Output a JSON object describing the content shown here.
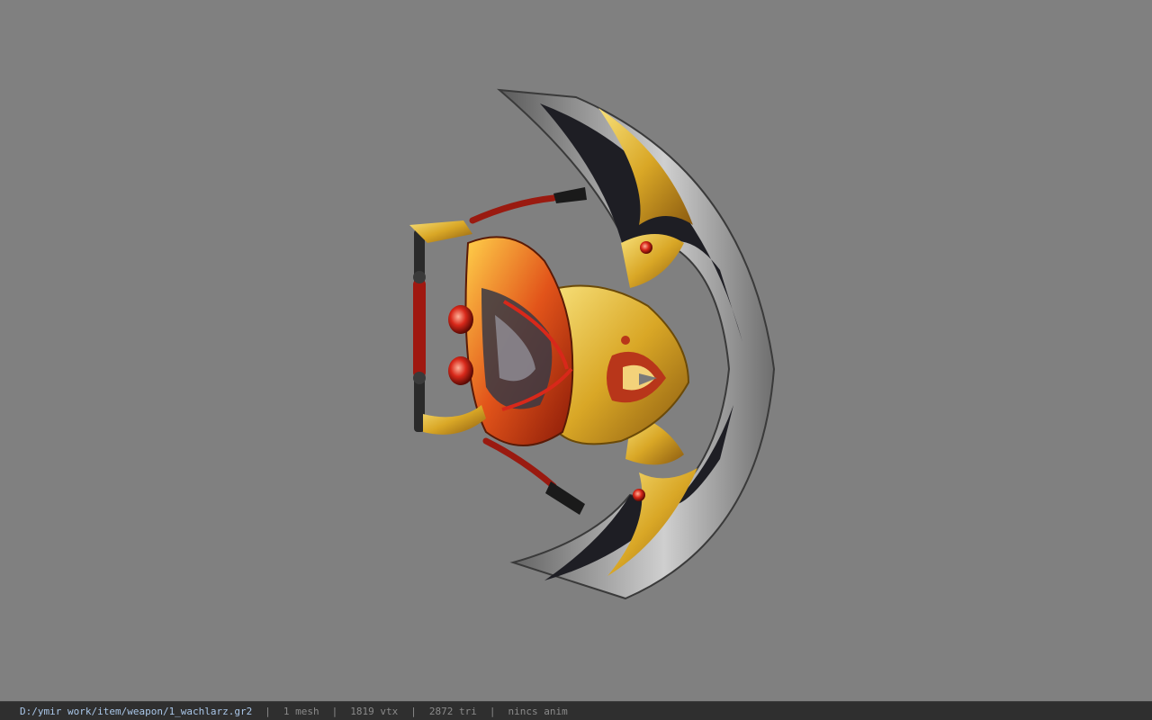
{
  "viewer": {
    "background": "#808080",
    "model": {
      "name": "1_wachlarz"
    }
  },
  "statusbar": {
    "file_path": "D:/ymir work/item/weapon/1_wachlarz.gr2",
    "separator": "|",
    "mesh_count": "1 mesh",
    "vertex_count": "1819 vtx",
    "triangle_count": "2872 tri",
    "anim_status": "nincs anim"
  }
}
